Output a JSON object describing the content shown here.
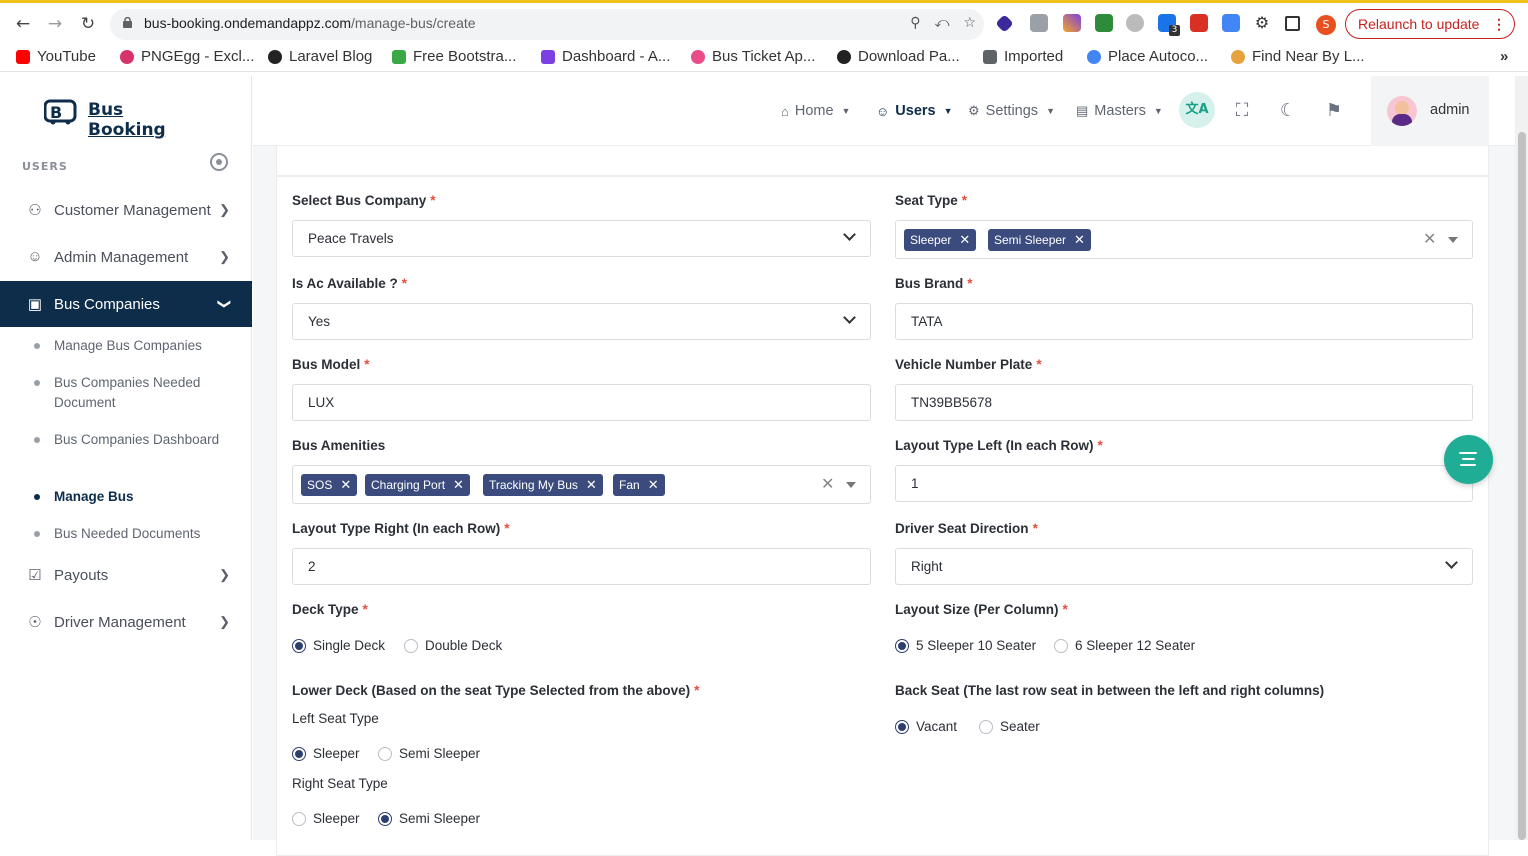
{
  "browser": {
    "url_host": "bus-booking.ondemandappz.com",
    "url_path": "/manage-bus/create",
    "relaunch_label": "Relaunch to update",
    "profile_initial": "S",
    "ext_badge": "3"
  },
  "bookmarks": [
    {
      "label": "YouTube",
      "color": "#ff0000"
    },
    {
      "label": "PNGEgg - Excl...",
      "color": "#d6336c"
    },
    {
      "label": "Laravel Blog",
      "color": "#222222"
    },
    {
      "label": "Free Bootstra...",
      "color": "#3aa845"
    },
    {
      "label": "Dashboard - A...",
      "color": "#7b3fe4"
    },
    {
      "label": "Bus Ticket Ap...",
      "color": "#ea4c89"
    },
    {
      "label": "Download Pa...",
      "color": "#222222"
    },
    {
      "label": "Imported",
      "color": "#5f6368"
    },
    {
      "label": "Place Autoco...",
      "color": "#4285f4"
    },
    {
      "label": "Find Near By L...",
      "color": "#e6a23c"
    }
  ],
  "sidebar": {
    "logo_text": "Bus Booking",
    "section_title": "USERS",
    "items": [
      {
        "label": "Customer Management"
      },
      {
        "label": "Admin Management"
      },
      {
        "label": "Bus Companies"
      },
      {
        "label": "Payouts"
      },
      {
        "label": "Driver Management"
      }
    ],
    "sub_items": [
      {
        "label": "Manage Bus Companies"
      },
      {
        "label": "Bus Companies Needed Document"
      },
      {
        "label": "Bus Companies Dashboard"
      },
      {
        "label": "Manage Bus"
      },
      {
        "label": "Bus Needed Documents"
      }
    ]
  },
  "topbar": {
    "nav": [
      {
        "label": "Home"
      },
      {
        "label": "Users"
      },
      {
        "label": "Settings"
      },
      {
        "label": "Masters"
      }
    ],
    "user_name": "admin"
  },
  "form": {
    "bus_company": {
      "label": "Select Bus Company",
      "value": "Peace Travels"
    },
    "seat_type": {
      "label": "Seat Type",
      "tags": [
        "Sleeper",
        "Semi Sleeper"
      ]
    },
    "ac": {
      "label": "Is Ac Available ?",
      "value": "Yes"
    },
    "brand": {
      "label": "Bus Brand",
      "value": "TATA"
    },
    "model": {
      "label": "Bus Model",
      "value": "LUX"
    },
    "plate": {
      "label": "Vehicle Number Plate",
      "value": "TN39BB5678"
    },
    "amenities": {
      "label": "Bus Amenities",
      "tags": [
        "SOS",
        "Charging Port",
        "Tracking My Bus",
        "Fan"
      ]
    },
    "layout_left": {
      "label": "Layout Type Left (In each Row)",
      "value": "1"
    },
    "layout_right": {
      "label": "Layout Type Right (In each Row)",
      "value": "2"
    },
    "driver_dir": {
      "label": "Driver Seat Direction",
      "value": "Right"
    },
    "deck_type": {
      "label": "Deck Type",
      "options": [
        "Single Deck",
        "Double Deck"
      ],
      "selected": "Single Deck"
    },
    "layout_size": {
      "label": "Layout Size (Per Column)",
      "options": [
        "5 Sleeper 10 Seater",
        "6 Sleeper 12 Seater"
      ],
      "selected": "5 Sleeper 10 Seater"
    },
    "lower_deck": {
      "label": "Lower Deck (Based on the seat Type Selected from the above)"
    },
    "left_seat": {
      "label": "Left Seat Type",
      "options": [
        "Sleeper",
        "Semi Sleeper"
      ],
      "selected": "Sleeper"
    },
    "right_seat": {
      "label": "Right Seat Type",
      "options": [
        "Sleeper",
        "Semi Sleeper"
      ],
      "selected": "Semi Sleeper"
    },
    "back_seat": {
      "label": "Back Seat (The last row seat in between the left and right columns)",
      "options": [
        "Vacant",
        "Seater"
      ],
      "selected": "Vacant"
    }
  }
}
